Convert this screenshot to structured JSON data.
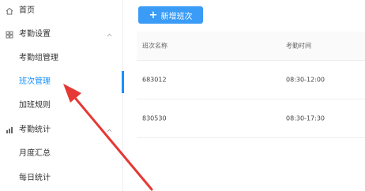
{
  "sidebar": {
    "items": [
      {
        "label": "首页",
        "icon": "home-icon",
        "type": "top"
      },
      {
        "label": "考勤设置",
        "icon": "grid-icon",
        "type": "group",
        "chevron": "chevron-up-icon"
      },
      {
        "label": "考勤组管理",
        "type": "sub"
      },
      {
        "label": "班次管理",
        "type": "sub",
        "active": true
      },
      {
        "label": "加班规则",
        "type": "sub"
      },
      {
        "label": "考勤统计",
        "icon": "bar-chart-icon",
        "type": "group",
        "chevron": "chevron-up-icon"
      },
      {
        "label": "月度汇总",
        "type": "sub"
      },
      {
        "label": "每日统计",
        "type": "sub"
      }
    ]
  },
  "toolbar": {
    "add_label": "新增班次"
  },
  "table": {
    "columns": [
      "班次名称",
      "考勤时间"
    ],
    "rows": [
      {
        "name": "683012",
        "time": "08:30-12:00"
      },
      {
        "name": "830530",
        "time": "08:30-17:30"
      }
    ]
  },
  "colors": {
    "accent": "#1890ff",
    "button": "#3a9cf7",
    "annotation": "#e53935"
  }
}
